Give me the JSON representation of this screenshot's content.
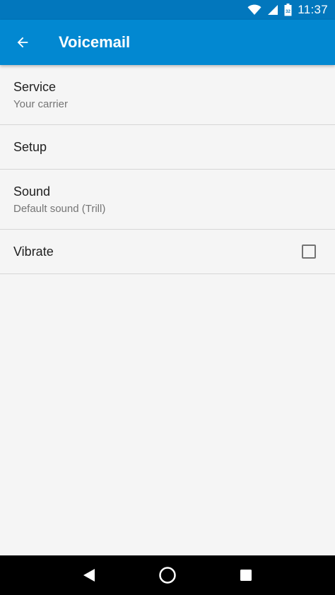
{
  "status_bar": {
    "time": "11:37",
    "icons": [
      "wifi-icon",
      "signal-icon",
      "battery-icon"
    ]
  },
  "app_bar": {
    "title": "Voicemail",
    "back_icon": "arrow-back-icon",
    "color": "#0288d1",
    "status_color": "#0277bd"
  },
  "settings": {
    "service": {
      "title": "Service",
      "summary": "Your carrier"
    },
    "setup": {
      "title": "Setup"
    },
    "sound": {
      "title": "Sound",
      "summary": "Default sound (Trill)"
    },
    "vibrate": {
      "title": "Vibrate",
      "checked": false
    }
  },
  "nav_bar": {
    "buttons": [
      "back-icon",
      "home-icon",
      "recents-icon"
    ]
  }
}
